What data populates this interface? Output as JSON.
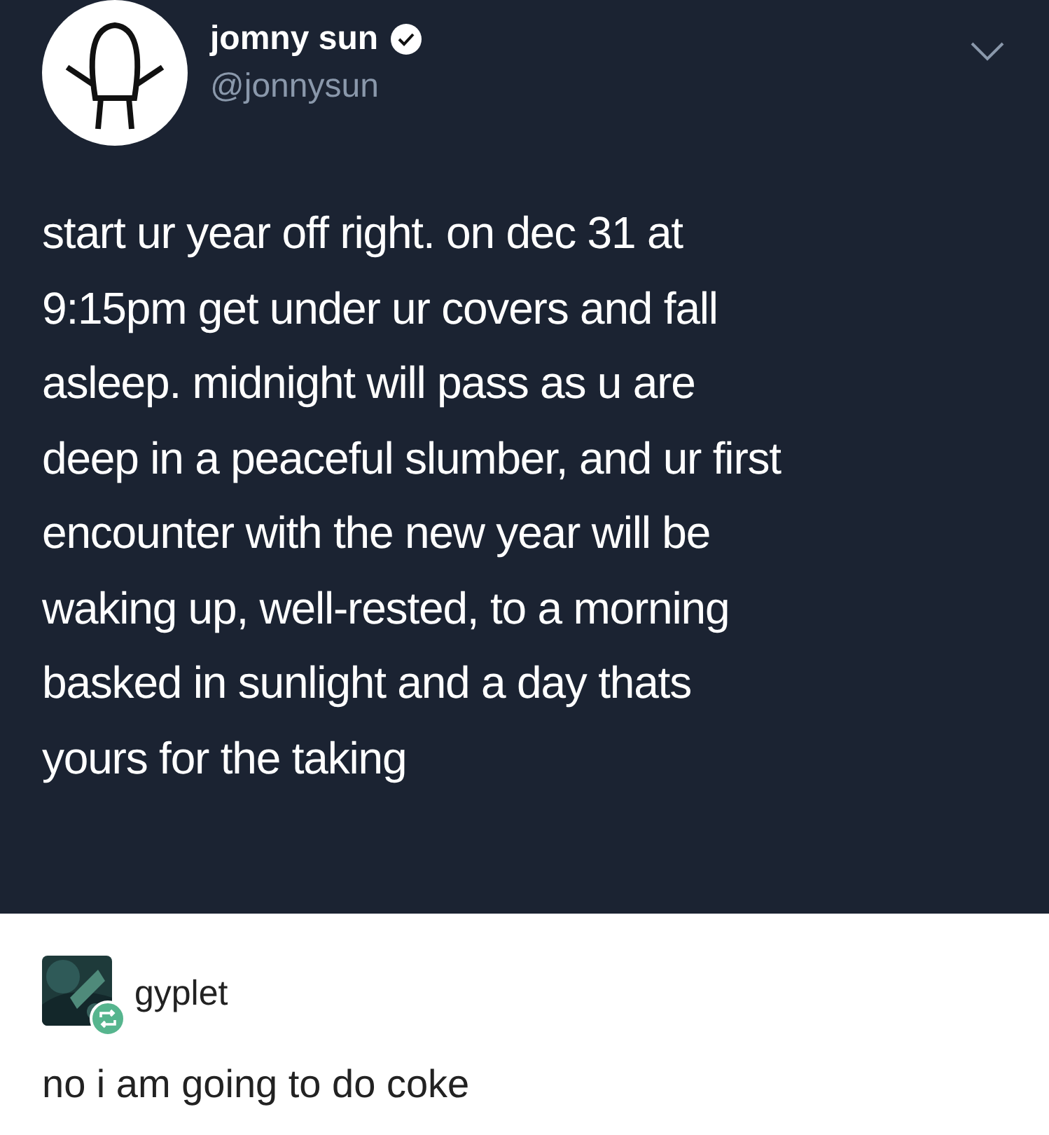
{
  "tweet": {
    "author_name": "jomny sun",
    "verified": true,
    "handle": "@jonnysun",
    "text_lines": [
      "start ur year off right. on dec 31 at",
      "9:15pm get under ur covers and fall",
      "asleep. midnight will pass as u are",
      "deep in a peaceful slumber, and ur first",
      "encounter with the new year will be",
      "waking up, well-rested, to a morning",
      "basked in sunlight and a day thats",
      "yours for the taking"
    ]
  },
  "reblog": {
    "username": "gyplet",
    "comment": "no i am going to do coke"
  }
}
